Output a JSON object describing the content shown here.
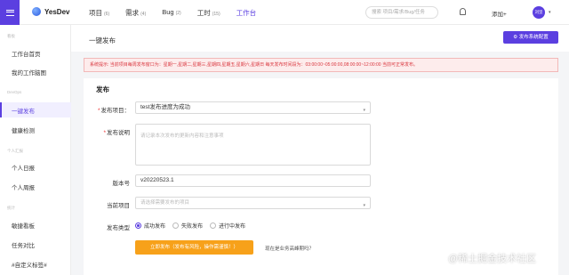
{
  "topbar": {
    "logo_text": "YesDev",
    "nav": [
      {
        "label": "项目",
        "count": "(6)"
      },
      {
        "label": "需求",
        "count": "(4)"
      },
      {
        "label": "Bug",
        "count": "(2)"
      },
      {
        "label": "工时",
        "count": "(15)"
      },
      {
        "label": "工作台",
        "count": ""
      }
    ],
    "search_placeholder": "搜索 项目/需求/Bug/任务",
    "add_label": "添加+",
    "avatar_text": "刘坚",
    "accent": "#5b3fe0"
  },
  "sidebar": {
    "groups": [
      "看板",
      "DevOps",
      "个人汇报",
      "统计"
    ],
    "items": [
      "工作台首页",
      "我的工作脑图",
      "一键发布",
      "健康检测",
      "个人日报",
      "个人周报",
      "敏捷看板",
      "任务对比",
      "#自定义标签#"
    ]
  },
  "page": {
    "title": "一键发布",
    "config_button": "⚙ 发布系统配置",
    "alert": "系统提示: 当前项目每周发布窗口为：星期一,星期二,星期三,星期四,星期五,星期六,星期日 每天发布时间段为：03:00:00~05:00:00,08:00:00~12:00:00 当前可正常发布。"
  },
  "form": {
    "section_title": "发布",
    "project_label": "发布项目：",
    "project_value": "test发布进度为成功",
    "desc_label": "发布说明",
    "desc_placeholder": "请记录本次发布的更新内容和注意事项",
    "version_label": "版本号",
    "version_value": "v20220523.1",
    "current_project_label": "当前项目",
    "current_project_placeholder": "请选择需要发布的项目",
    "type_label": "发布类型",
    "types": [
      "成功发布",
      "失败发布",
      "进行中发布"
    ],
    "selected_type": "成功发布",
    "submit_label": "立即发布（发布有风险，操作需谨慎！）",
    "peak_question": "现在是业务高峰期吗？"
  },
  "watermark": "@稀土掘金技术社区"
}
